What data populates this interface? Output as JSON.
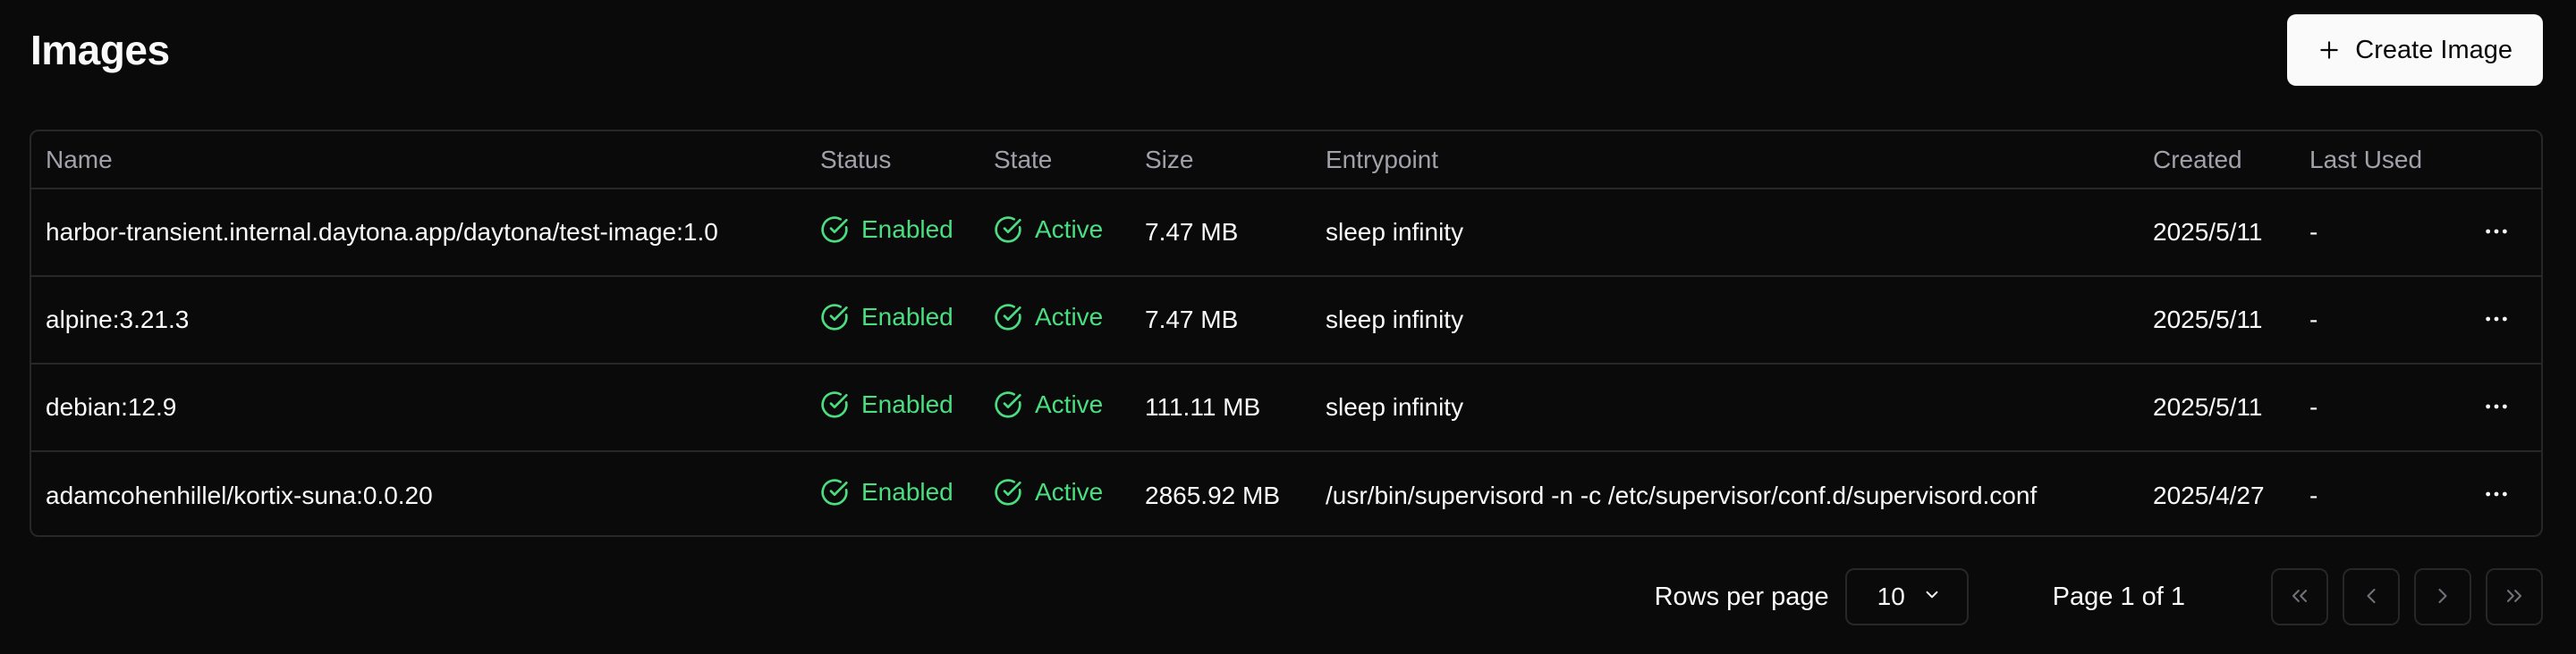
{
  "header": {
    "title": "Images",
    "create_button_label": "Create Image"
  },
  "table": {
    "columns": [
      "Name",
      "Status",
      "State",
      "Size",
      "Entrypoint",
      "Created",
      "Last Used"
    ],
    "rows": [
      {
        "name": "harbor-transient.internal.daytona.app/daytona/test-image:1.0",
        "status": "Enabled",
        "state": "Active",
        "size": "7.47 MB",
        "entrypoint": "sleep infinity",
        "created": "2025/5/11",
        "last_used": "-"
      },
      {
        "name": "alpine:3.21.3",
        "status": "Enabled",
        "state": "Active",
        "size": "7.47 MB",
        "entrypoint": "sleep infinity",
        "created": "2025/5/11",
        "last_used": "-"
      },
      {
        "name": "debian:12.9",
        "status": "Enabled",
        "state": "Active",
        "size": "111.11 MB",
        "entrypoint": "sleep infinity",
        "created": "2025/5/11",
        "last_used": "-"
      },
      {
        "name": "adamcohenhillel/kortix-suna:0.0.20",
        "status": "Enabled",
        "state": "Active",
        "size": "2865.92 MB",
        "entrypoint": "/usr/bin/supervisord -n -c /etc/supervisor/conf.d/supervisord.conf",
        "created": "2025/4/27",
        "last_used": "-"
      }
    ]
  },
  "pagination": {
    "rows_per_page_label": "Rows per page",
    "rows_per_page_value": "10",
    "page_indicator": "Page 1 of 1"
  },
  "colors": {
    "background": "#0a0a0a",
    "border": "#27272a",
    "muted_text": "#a1a1aa",
    "status_green": "#4ade80",
    "primary_button_bg": "#fafafa"
  },
  "icons": {
    "create": "plus-icon",
    "status": "circle-check-icon",
    "row_menu": "more-horizontal-icon",
    "select": "chevron-down-icon",
    "first_page": "chevrons-left-icon",
    "prev_page": "chevron-left-icon",
    "next_page": "chevron-right-icon",
    "last_page": "chevrons-right-icon"
  }
}
